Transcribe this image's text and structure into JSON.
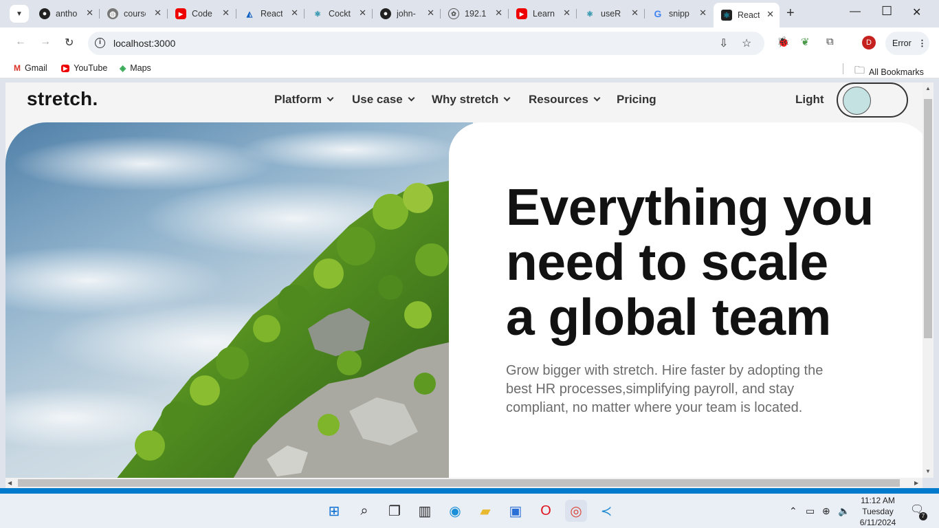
{
  "browser": {
    "tabs": [
      {
        "title": "anthony",
        "icon": "github-icon"
      },
      {
        "title": "course",
        "icon": "globe-icon"
      },
      {
        "title": "Code",
        "icon": "youtube-icon"
      },
      {
        "title": "React",
        "icon": "react-router-icon"
      },
      {
        "title": "Cockt",
        "icon": "react-icon"
      },
      {
        "title": "john-",
        "icon": "github-icon"
      },
      {
        "title": "192.1",
        "icon": "openai-icon"
      },
      {
        "title": "Learn",
        "icon": "youtube-icon"
      },
      {
        "title": "useR",
        "icon": "react-icon"
      },
      {
        "title": "snipp",
        "icon": "google-icon"
      },
      {
        "title": "React",
        "icon": "react-icon",
        "active": true
      }
    ],
    "url": "localhost:3000",
    "profile_initial": "D",
    "error_label": "Error",
    "bookmarks": [
      {
        "label": "Gmail",
        "icon": "gmail-icon"
      },
      {
        "label": "YouTube",
        "icon": "youtube-icon"
      },
      {
        "label": "Maps",
        "icon": "maps-icon"
      }
    ],
    "all_bookmarks": "All Bookmarks"
  },
  "page": {
    "logo": "stretch.",
    "nav": [
      {
        "label": "Platform",
        "has_dropdown": true
      },
      {
        "label": "Use case",
        "has_dropdown": true
      },
      {
        "label": "Why stretch",
        "has_dropdown": true
      },
      {
        "label": "Resources",
        "has_dropdown": true
      },
      {
        "label": "Pricing",
        "has_dropdown": false
      }
    ],
    "theme_label": "Light",
    "hero": {
      "line1": "Everything you",
      "line2": "need to scale",
      "line3": "a global team",
      "subtitle": "Grow bigger with stretch. Hire faster by adopting the best HR processes,simplifying payroll, and stay compliant, no matter where your team is located."
    }
  },
  "taskbar": {
    "time": "11:12 AM",
    "day": "Tuesday",
    "date": "6/11/2024",
    "notifications": "7"
  },
  "colors": {
    "accent_toggle": "#c4e2e2",
    "vscode_status": "#007acc"
  }
}
